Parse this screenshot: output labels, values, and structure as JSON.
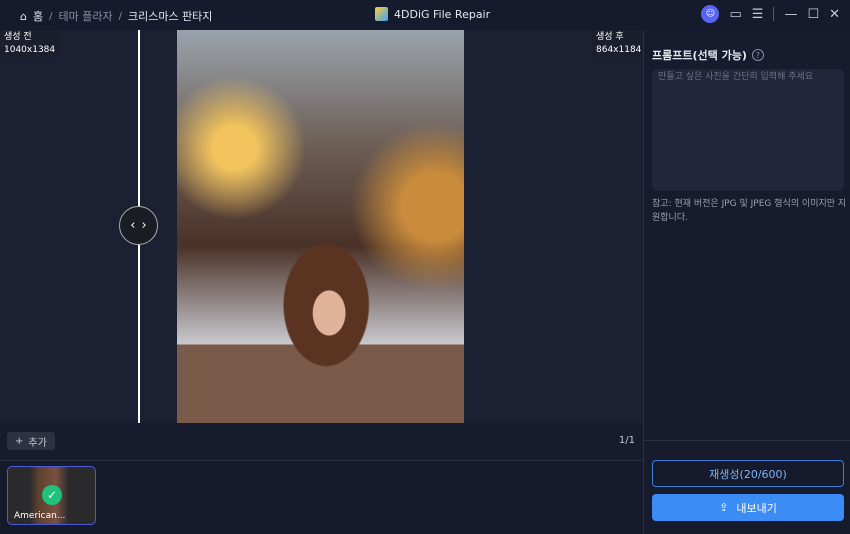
{
  "breadcrumb": {
    "home": "홈",
    "theme": "테마 플라자",
    "current": "크리스마스 판타지"
  },
  "app": {
    "title": "4DDiG File Repair"
  },
  "compare": {
    "before_label": "생성 전",
    "before_size": "1040x1384",
    "after_label": "생성 후",
    "after_size": "864x1184"
  },
  "toolbar": {
    "add_label": "추가",
    "pager": "1/1"
  },
  "thumbnails": [
    {
      "name": "American..."
    }
  ],
  "panel": {
    "title": "프롬프트(선택 가능)",
    "placeholder": "만들고 싶은 사진을 간단히 입력해 주세요",
    "note": "참고: 현재 버전은 JPG 및 JPEG 형식의 이미지만 지원합니다.",
    "regen_label": "재생성(20/600)",
    "export_label": "내보내기"
  }
}
